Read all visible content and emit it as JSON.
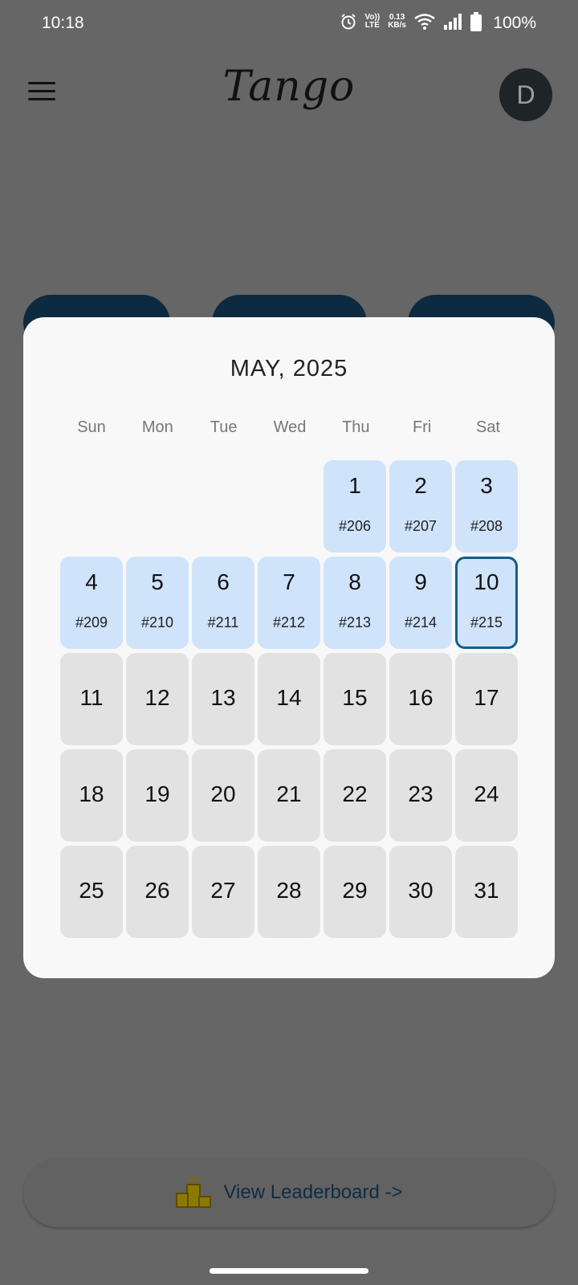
{
  "status_bar": {
    "time": "10:18",
    "volte_top": "Vo))",
    "volte_bottom": "LTE",
    "net_speed_top": "0.13",
    "net_speed_bottom": "KB/s",
    "battery": "100%"
  },
  "app_bar": {
    "title": "Tango",
    "avatar_letter": "D"
  },
  "calendar": {
    "month_title": "MAY, 2025",
    "weekdays": [
      "Sun",
      "Mon",
      "Tue",
      "Wed",
      "Thu",
      "Fri",
      "Sat"
    ],
    "leading_empty_days": 4,
    "selected_day": "10",
    "days": [
      {
        "day": "1",
        "puzzle": "#206"
      },
      {
        "day": "2",
        "puzzle": "#207"
      },
      {
        "day": "3",
        "puzzle": "#208"
      },
      {
        "day": "4",
        "puzzle": "#209"
      },
      {
        "day": "5",
        "puzzle": "#210"
      },
      {
        "day": "6",
        "puzzle": "#211"
      },
      {
        "day": "7",
        "puzzle": "#212"
      },
      {
        "day": "8",
        "puzzle": "#213"
      },
      {
        "day": "9",
        "puzzle": "#214"
      },
      {
        "day": "10",
        "puzzle": "#215"
      },
      {
        "day": "11",
        "puzzle": ""
      },
      {
        "day": "12",
        "puzzle": ""
      },
      {
        "day": "13",
        "puzzle": ""
      },
      {
        "day": "14",
        "puzzle": ""
      },
      {
        "day": "15",
        "puzzle": ""
      },
      {
        "day": "16",
        "puzzle": ""
      },
      {
        "day": "17",
        "puzzle": ""
      },
      {
        "day": "18",
        "puzzle": ""
      },
      {
        "day": "19",
        "puzzle": ""
      },
      {
        "day": "20",
        "puzzle": ""
      },
      {
        "day": "21",
        "puzzle": ""
      },
      {
        "day": "22",
        "puzzle": ""
      },
      {
        "day": "23",
        "puzzle": ""
      },
      {
        "day": "24",
        "puzzle": ""
      },
      {
        "day": "25",
        "puzzle": ""
      },
      {
        "day": "26",
        "puzzle": ""
      },
      {
        "day": "27",
        "puzzle": ""
      },
      {
        "day": "28",
        "puzzle": ""
      },
      {
        "day": "29",
        "puzzle": ""
      },
      {
        "day": "30",
        "puzzle": ""
      },
      {
        "day": "31",
        "puzzle": ""
      }
    ]
  },
  "leaderboard": {
    "label": "View Leaderboard  ->",
    "icon": "podium-icon"
  },
  "colors": {
    "played_cell": "#cfe3fb",
    "future_cell": "#e2e2e2",
    "selected_border": "#0f5f8a",
    "scrim": "#666666"
  }
}
